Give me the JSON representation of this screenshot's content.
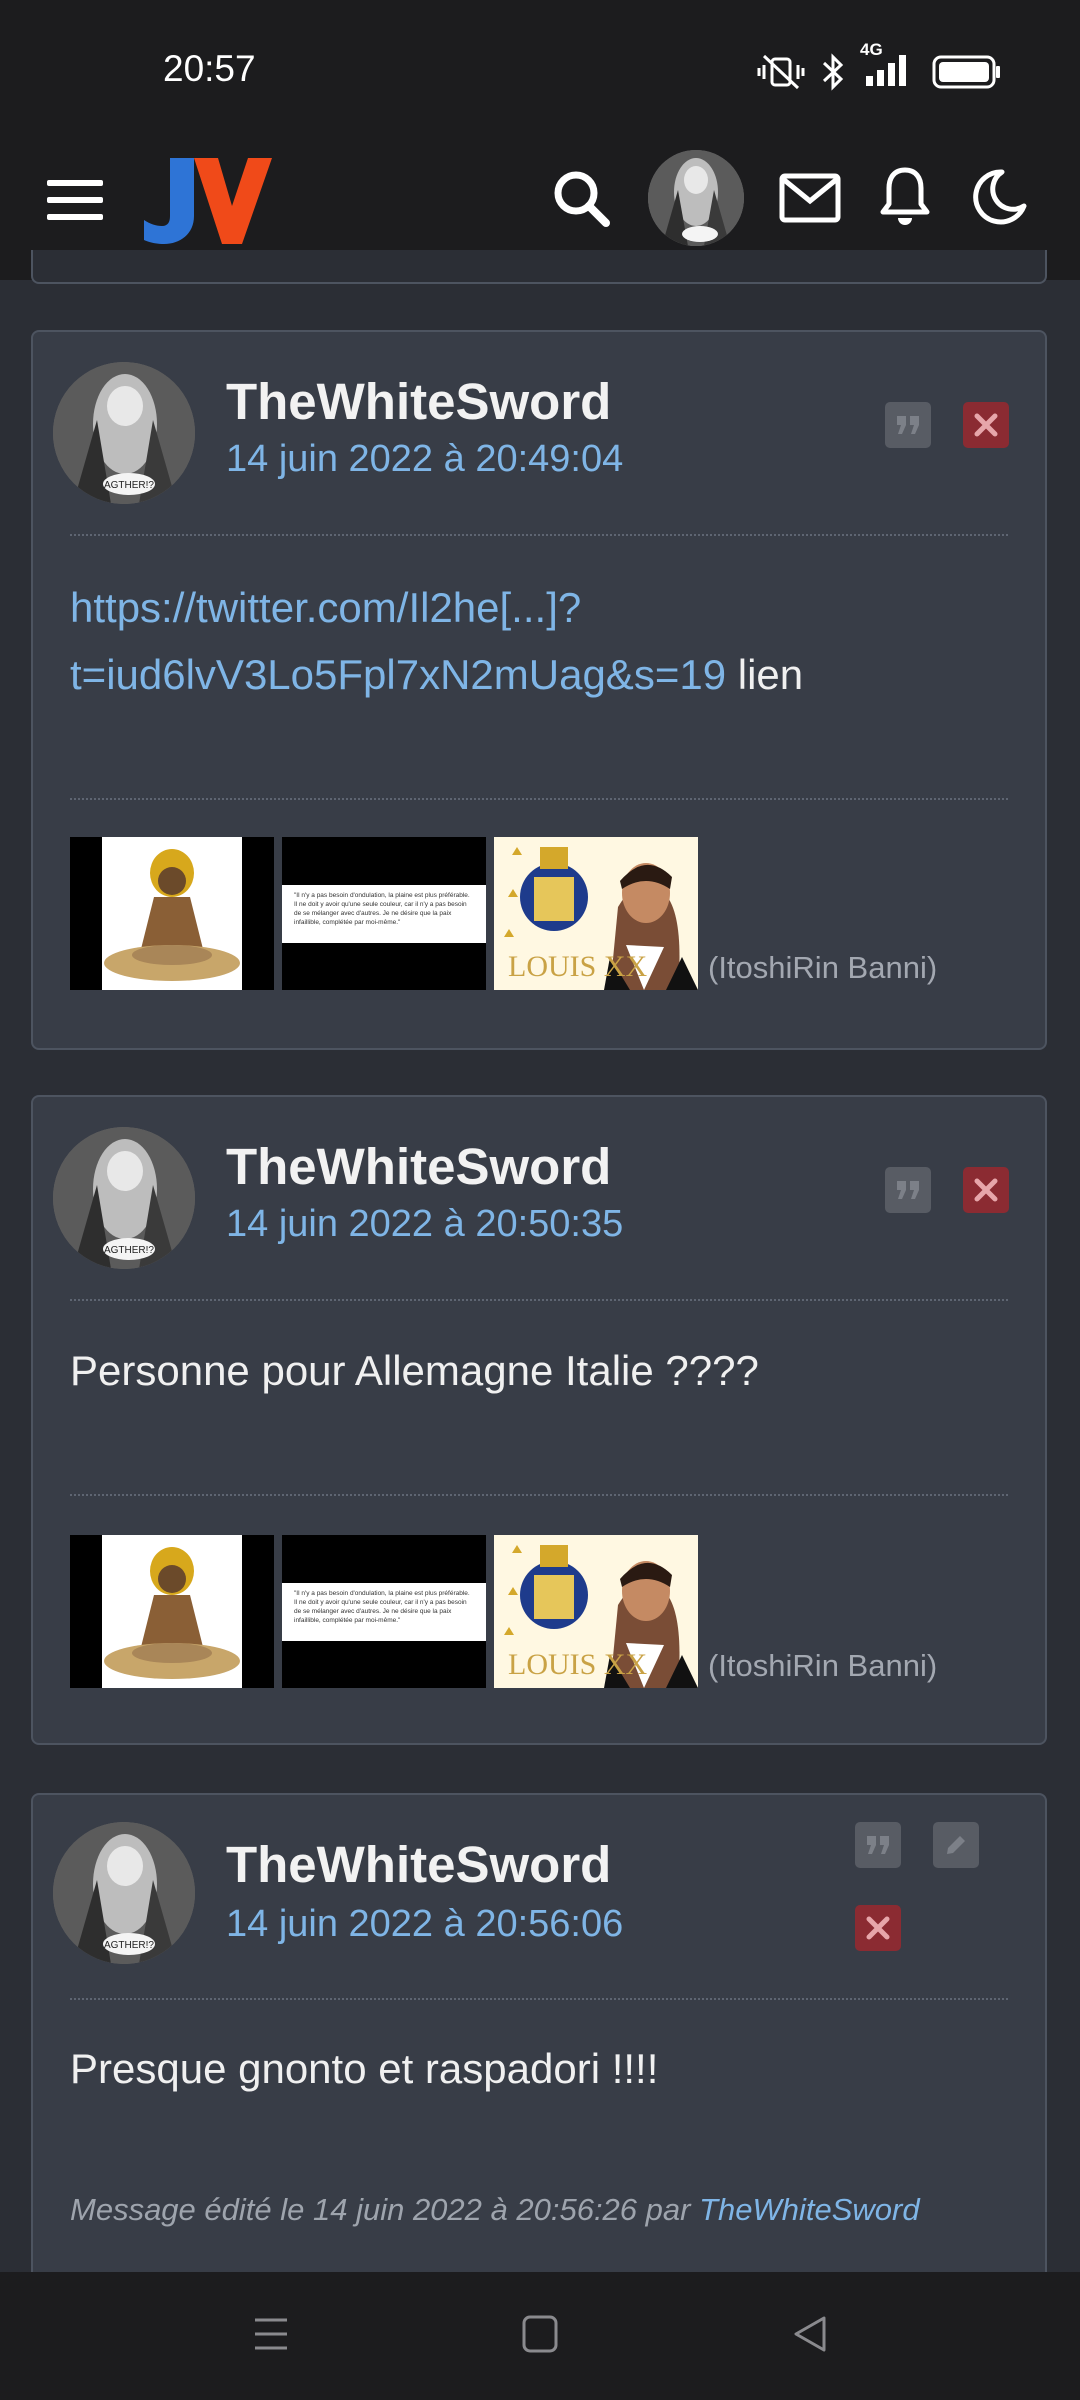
{
  "status_bar": {
    "time": "20:57",
    "network": "4G"
  },
  "header": {
    "logo_text": "JV",
    "icons": [
      "menu-icon",
      "search-icon",
      "avatar",
      "mail-icon",
      "bell-icon",
      "moon-icon"
    ]
  },
  "posts": [
    {
      "author": "TheWhiteSword",
      "date": "14 juin 2022 à 20:49:04",
      "link_line1": "https://twitter.com/Il2he[...]?",
      "link_line2": "t=iud6lvV3Lo5Fpl7xN2mUag&s=19",
      "text_after_link": " lien",
      "signature_note": "(ItoshiRin Banni)",
      "quote_thumb_text": "\"Il n'y a pas besoin d'ondulation, la plaine est plus préférable. Il ne doit y avoir qu'une seule couleur, car il n'y a pas besoin de se mélanger avec d'autres. Je ne désire que la paix infaillible, complétée par moi-même.\"",
      "louis_thumb_text": "LOUIS XX"
    },
    {
      "author": "TheWhiteSword",
      "date": "14 juin 2022 à 20:50:35",
      "text": "Personne pour Allemagne Italie ????",
      "signature_note": "(ItoshiRin Banni)",
      "quote_thumb_text": "\"Il n'y a pas besoin d'ondulation, la plaine est plus préférable. Il ne doit y avoir qu'une seule couleur, car il n'y a pas besoin de se mélanger avec d'autres. Je ne désire que la paix infaillible, complétée par moi-même.\"",
      "louis_thumb_text": "LOUIS XX"
    },
    {
      "author": "TheWhiteSword",
      "date": "14 juin 2022 à 20:56:06",
      "text": "Presque gnonto et raspadori !!!!",
      "edited_prefix": "Message édité le 14 juin 2022 à 20:56:26 par ",
      "edited_by": "TheWhiteSword"
    }
  ],
  "avatar_caption": "AGTHER!?",
  "colors": {
    "background": "#2b2e35",
    "card": "#383d47",
    "link": "#7fb5e6",
    "delete_button": "#8b2b32",
    "logo_blue": "#2e74d6",
    "logo_orange": "#f04a19"
  }
}
